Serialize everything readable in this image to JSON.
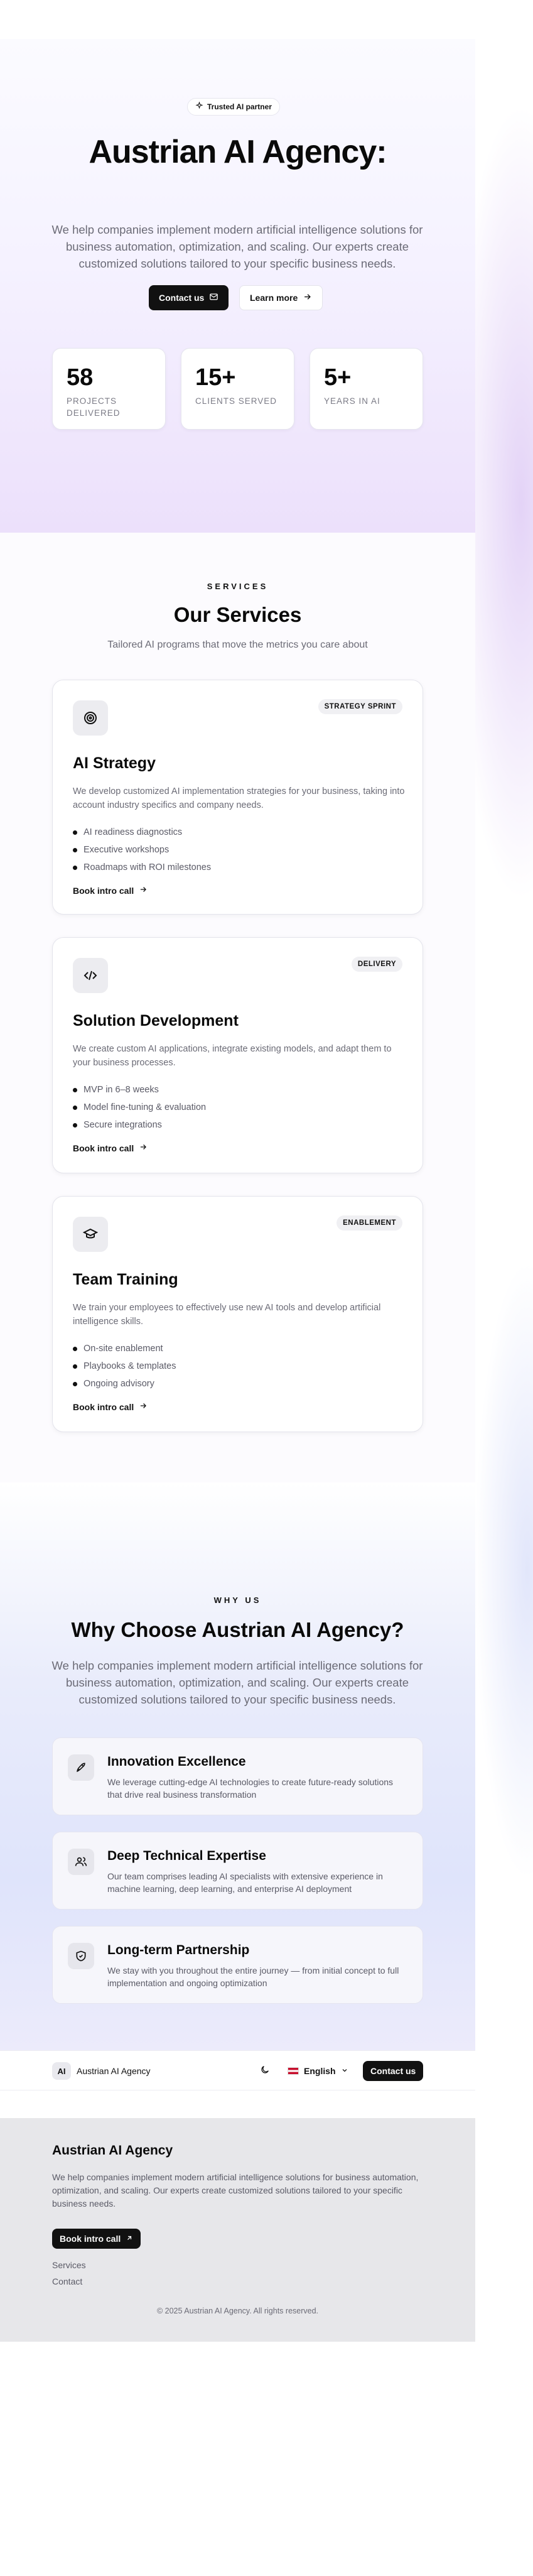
{
  "hero": {
    "badge": "Trusted AI partner",
    "title": "Austrian AI Agency:",
    "subtitle": "We help companies implement modern artificial intelligence solutions for business automation, optimization, and scaling. Our experts create customized solutions tailored to your specific business needs.",
    "contact_label": "Contact us",
    "learn_label": "Learn more",
    "stats": [
      {
        "value": "58",
        "label": "PROJECTS DELIVERED"
      },
      {
        "value": "15+",
        "label": "CLIENTS SERVED"
      },
      {
        "value": "5+",
        "label": "YEARS IN AI"
      }
    ]
  },
  "services": {
    "eyebrow": "SERVICES",
    "title": "Our Services",
    "subtitle": "Tailored AI programs that move the metrics you care about",
    "cards": [
      {
        "icon": "target-icon",
        "tag": "STRATEGY SPRINT",
        "title": "AI Strategy",
        "description": "We develop customized AI implementation strategies for your business, taking into account industry specifics and company needs.",
        "bullets": [
          "AI readiness diagnostics",
          "Executive workshops",
          "Roadmaps with ROI milestones"
        ],
        "cta": "Book intro call"
      },
      {
        "icon": "code-icon",
        "tag": "DELIVERY",
        "title": "Solution Development",
        "description": "We create custom AI applications, integrate existing models, and adapt them to your business processes.",
        "bullets": [
          "MVP in 6–8 weeks",
          "Model fine-tuning & evaluation",
          "Secure integrations"
        ],
        "cta": "Book intro call"
      },
      {
        "icon": "graduation-cap-icon",
        "tag": "ENABLEMENT",
        "title": "Team Training",
        "description": "We train your employees to effectively use new AI tools and develop artificial intelligence skills.",
        "bullets": [
          "On-site enablement",
          "Playbooks & templates",
          "Ongoing advisory"
        ],
        "cta": "Book intro call"
      }
    ]
  },
  "why": {
    "eyebrow": "WHY US",
    "title": "Why Choose Austrian AI Agency?",
    "subtitle": "We help companies implement modern artificial intelligence solutions for business automation, optimization, and scaling. Our experts create customized solutions tailored to your specific business needs.",
    "features": [
      {
        "icon": "rocket-icon",
        "title": "Innovation Excellence",
        "description": "We leverage cutting-edge AI technologies to create future-ready solutions that drive real business transformation"
      },
      {
        "icon": "users-icon",
        "title": "Deep Technical Expertise",
        "description": "Our team comprises leading AI specialists with extensive experience in machine learning, deep learning, and enterprise AI deployment"
      },
      {
        "icon": "shield-check-icon",
        "title": "Long-term Partnership",
        "description": "We stay with you throughout the entire journey — from initial concept to full implementation and ongoing optimization"
      }
    ]
  },
  "nav": {
    "logo": "AI",
    "brand": "Austrian AI Agency",
    "language": "English",
    "contact_label": "Contact us"
  },
  "footer": {
    "title": "Austrian AI Agency",
    "description": "We help companies implement modern artificial intelligence solutions for business automation, optimization, and scaling. Our experts create customized solutions tailored to your specific business needs.",
    "cta": "Book intro call",
    "links": [
      "Services",
      "Contact"
    ],
    "copyright": "© 2025 Austrian AI Agency. All rights reserved."
  }
}
